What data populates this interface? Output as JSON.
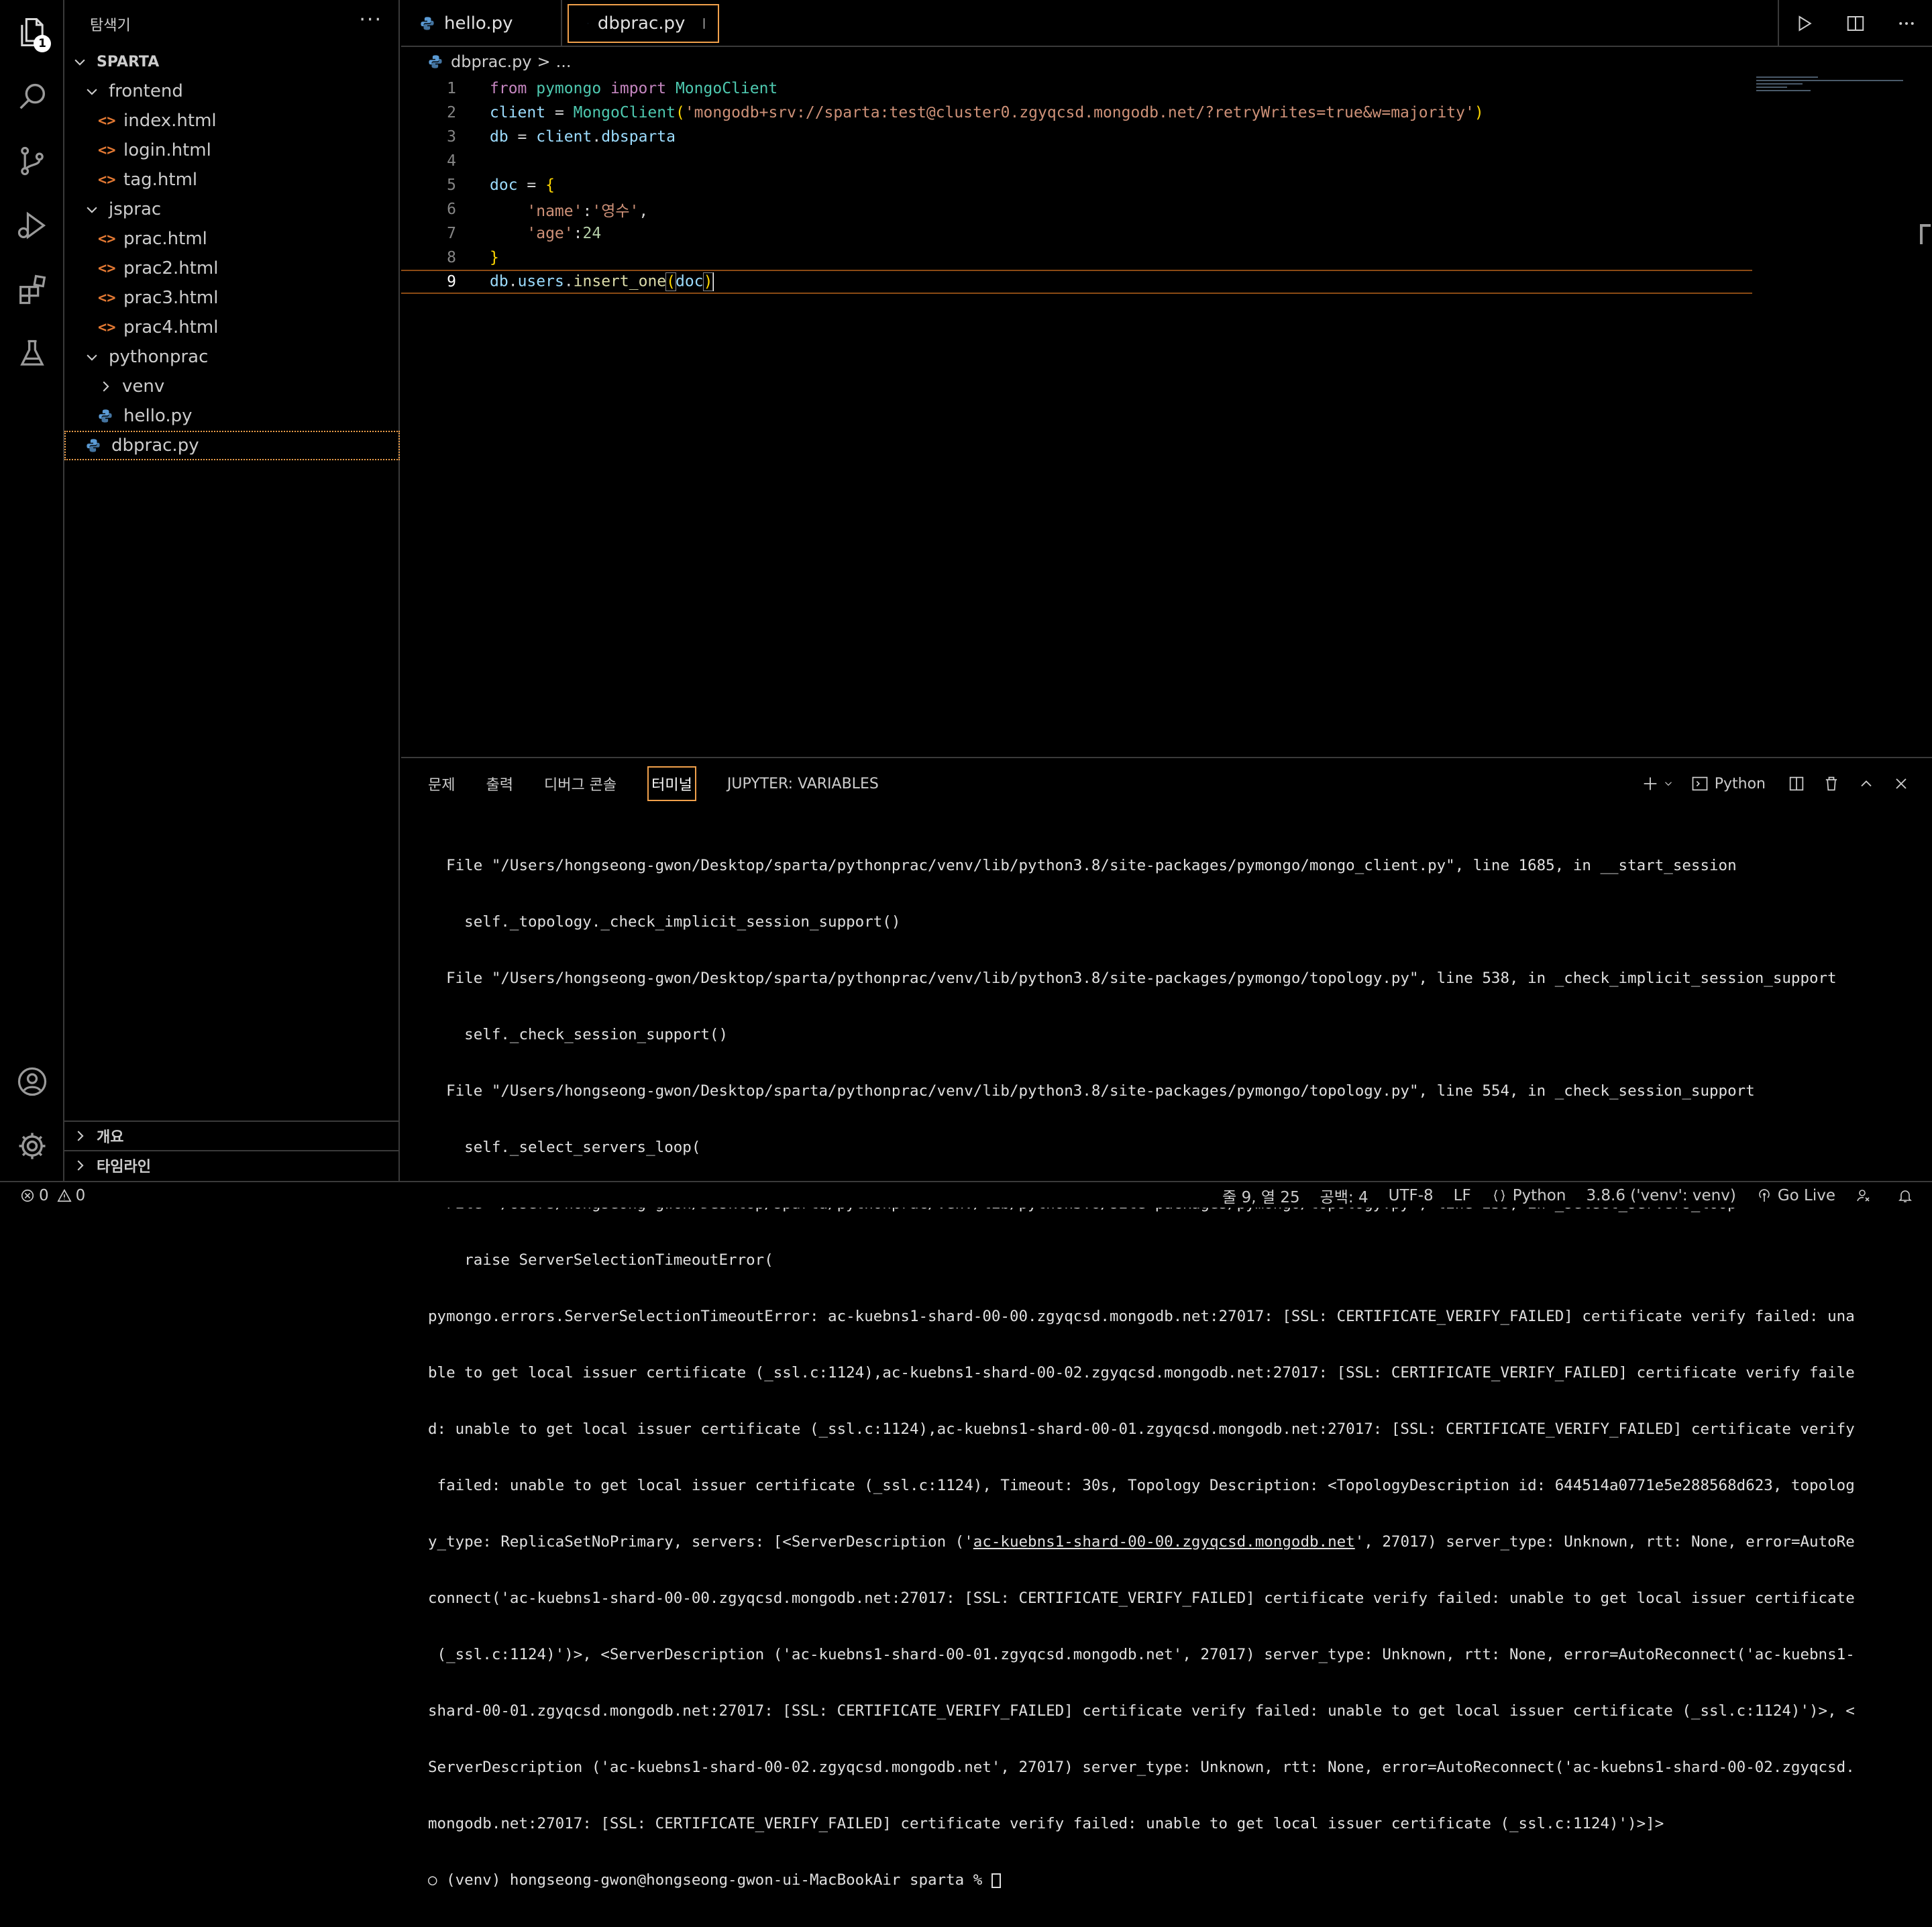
{
  "explorer": {
    "title": "탐색기",
    "more": "···",
    "root": "SPARTA",
    "items": [
      {
        "label": "frontend"
      },
      {
        "label": "index.html"
      },
      {
        "label": "login.html"
      },
      {
        "label": "tag.html"
      },
      {
        "label": "jsprac"
      },
      {
        "label": "prac.html"
      },
      {
        "label": "prac2.html"
      },
      {
        "label": "prac3.html"
      },
      {
        "label": "prac4.html"
      },
      {
        "label": "pythonprac"
      },
      {
        "label": "venv"
      },
      {
        "label": "hello.py"
      },
      {
        "label": "dbprac.py"
      }
    ],
    "outline": "개요",
    "timeline": "타임라인"
  },
  "activity": {
    "badge": "1"
  },
  "tabs": [
    {
      "label": "hello.py"
    },
    {
      "label": "dbprac.py"
    }
  ],
  "breadcrumb": {
    "file": "dbprac.py",
    "sep": ">",
    "rest": "..."
  },
  "editor": {
    "line_numbers": [
      "1",
      "2",
      "3",
      "4",
      "5",
      "6",
      "7",
      "8",
      "9"
    ],
    "l1": {
      "a": "from",
      "b": " pymongo ",
      "c": "import",
      "d": " MongoClient"
    },
    "l2": {
      "a": "client",
      "b": " = ",
      "c": "MongoClient",
      "d": "(",
      "e": "'mongodb+srv://sparta:test@cluster0.zgyqcsd.mongodb.net/?retryWrites=true&w=majority'",
      "f": ")"
    },
    "l3": {
      "a": "db",
      "b": " = ",
      "c": "client",
      "d": ".",
      "e": "dbsparta"
    },
    "l5": {
      "a": "doc",
      "b": " = ",
      "c": "{"
    },
    "l6": {
      "a": "    ",
      "b": "'name'",
      "c": ":",
      "d": "'영수'",
      "e": ","
    },
    "l7": {
      "a": "    ",
      "b": "'age'",
      "c": ":",
      "d": "24"
    },
    "l8": {
      "a": "}"
    },
    "l9": {
      "a": "db",
      "b": ".",
      "c": "users",
      "d": ".",
      "e": "insert_one",
      "f": "(",
      "g": "doc",
      "h": ")"
    }
  },
  "panel": {
    "tabs": [
      "문제",
      "출력",
      "디버그 콘솔",
      "터미널",
      "JUPYTER: VARIABLES"
    ],
    "shell": "Python",
    "terminal_lines": [
      "  File \"/Users/hongseong-gwon/Desktop/sparta/pythonprac/venv/lib/python3.8/site-packages/pymongo/mongo_client.py\", line 1685, in __start_session",
      "    self._topology._check_implicit_session_support()",
      "  File \"/Users/hongseong-gwon/Desktop/sparta/pythonprac/venv/lib/python3.8/site-packages/pymongo/topology.py\", line 538, in _check_implicit_session_support",
      "    self._check_session_support()",
      "  File \"/Users/hongseong-gwon/Desktop/sparta/pythonprac/venv/lib/python3.8/site-packages/pymongo/topology.py\", line 554, in _check_session_support",
      "    self._select_servers_loop(",
      "  File \"/Users/hongseong-gwon/Desktop/sparta/pythonprac/venv/lib/python3.8/site-packages/pymongo/topology.py\", line 238, in _select_servers_loop",
      "    raise ServerSelectionTimeoutError(",
      "pymongo.errors.ServerSelectionTimeoutError: ac-kuebns1-shard-00-00.zgyqcsd.mongodb.net:27017: [SSL: CERTIFICATE_VERIFY_FAILED] certificate verify failed: una",
      "ble to get local issuer certificate (_ssl.c:1124),ac-kuebns1-shard-00-02.zgyqcsd.mongodb.net:27017: [SSL: CERTIFICATE_VERIFY_FAILED] certificate verify faile",
      "d: unable to get local issuer certificate (_ssl.c:1124),ac-kuebns1-shard-00-01.zgyqcsd.mongodb.net:27017: [SSL: CERTIFICATE_VERIFY_FAILED] certificate verify",
      " failed: unable to get local issuer certificate (_ssl.c:1124), Timeout: 30s, Topology Description: <TopologyDescription id: 644514a0771e5e288568d623, topolog",
      "y_type: ReplicaSetNoPrimary, servers: [<ServerDescription ('",
      "connect('ac-kuebns1-shard-00-00.zgyqcsd.mongodb.net:27017: [SSL: CERTIFICATE_VERIFY_FAILED] certificate verify failed: unable to get local issuer certificate",
      " (_ssl.c:1124)')>, <ServerDescription ('ac-kuebns1-shard-00-01.zgyqcsd.mongodb.net', 27017) server_type: Unknown, rtt: None, error=AutoReconnect('ac-kuebns1-",
      "shard-00-01.zgyqcsd.mongodb.net:27017: [SSL: CERTIFICATE_VERIFY_FAILED] certificate verify failed: unable to get local issuer certificate (_ssl.c:1124)')>, <",
      "ServerDescription ('ac-kuebns1-shard-00-02.zgyqcsd.mongodb.net', 27017) server_type: Unknown, rtt: None, error=AutoReconnect('ac-kuebns1-shard-00-02.zgyqcsd.",
      "mongodb.net:27017: [SSL: CERTIFICATE_VERIFY_FAILED] certificate verify failed: unable to get local issuer certificate (_ssl.c:1124)')>]>"
    ],
    "link_text": "ac-kuebns1-shard-00-00.zgyqcsd.mongodb.net",
    "link_after": "', 27017) server_type: Unknown, rtt: None, error=AutoRe",
    "prompt": "○ (venv) hongseong-gwon@hongseong-gwon-ui-MacBookAir sparta % "
  },
  "status": {
    "errors": "0",
    "warnings": "0",
    "position": "줄 9, 열 25",
    "spaces": "공백: 4",
    "encoding": "UTF-8",
    "eol": "LF",
    "language": "Python",
    "interpreter": "3.8.6 ('venv': venv)",
    "golive": "Go Live"
  }
}
